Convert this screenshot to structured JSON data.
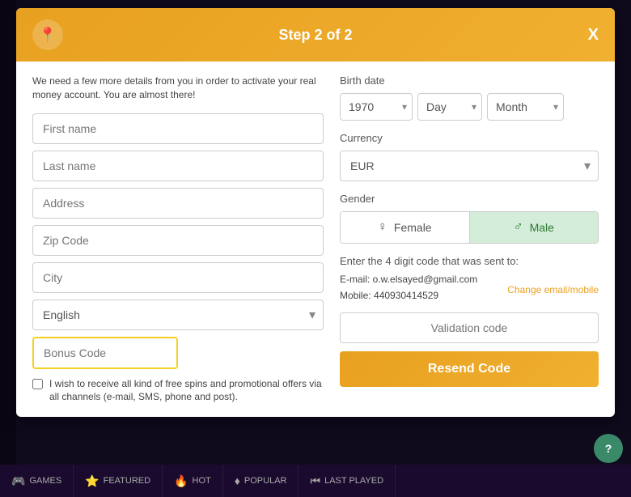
{
  "modal": {
    "title": "Step 2 of 2",
    "close_label": "X",
    "subtitle": "We need a few more details from you in order to activate your real money account. You are almost there!"
  },
  "left_form": {
    "first_name_placeholder": "First name",
    "last_name_placeholder": "Last name",
    "address_placeholder": "Address",
    "zip_code_placeholder": "Zip Code",
    "city_placeholder": "City",
    "language_placeholder": "English",
    "bonus_code_placeholder": "Bonus Code",
    "checkbox_label": "I wish to receive all kind of free spins and promotional offers via all channels (e-mail, SMS, phone and post)."
  },
  "right_form": {
    "birth_date_label": "Birth date",
    "year_value": "1970",
    "day_placeholder": "Day",
    "month_placeholder": "Month",
    "currency_label": "Currency",
    "currency_value": "EUR",
    "gender_label": "Gender",
    "female_label": "Female",
    "male_label": "Male",
    "validation_label": "Enter the 4 digit code that was sent to:",
    "email_label": "E-mail: o.w.elsayed@gmail.com",
    "mobile_label": "Mobile: 440930414529",
    "change_link": "Change email/mobile",
    "validation_placeholder": "Validation code",
    "resend_label": "Resend Code"
  },
  "bottom_bar": {
    "items": [
      {
        "icon": "🎮",
        "label": "GAMES"
      },
      {
        "icon": "🔥",
        "label": "HOT"
      },
      {
        "icon": "🔥",
        "label": "FEATURED"
      },
      {
        "icon": "⭐",
        "label": "POPULAR"
      },
      {
        "icon": "⏮",
        "label": "LAST PLAYED"
      }
    ]
  }
}
